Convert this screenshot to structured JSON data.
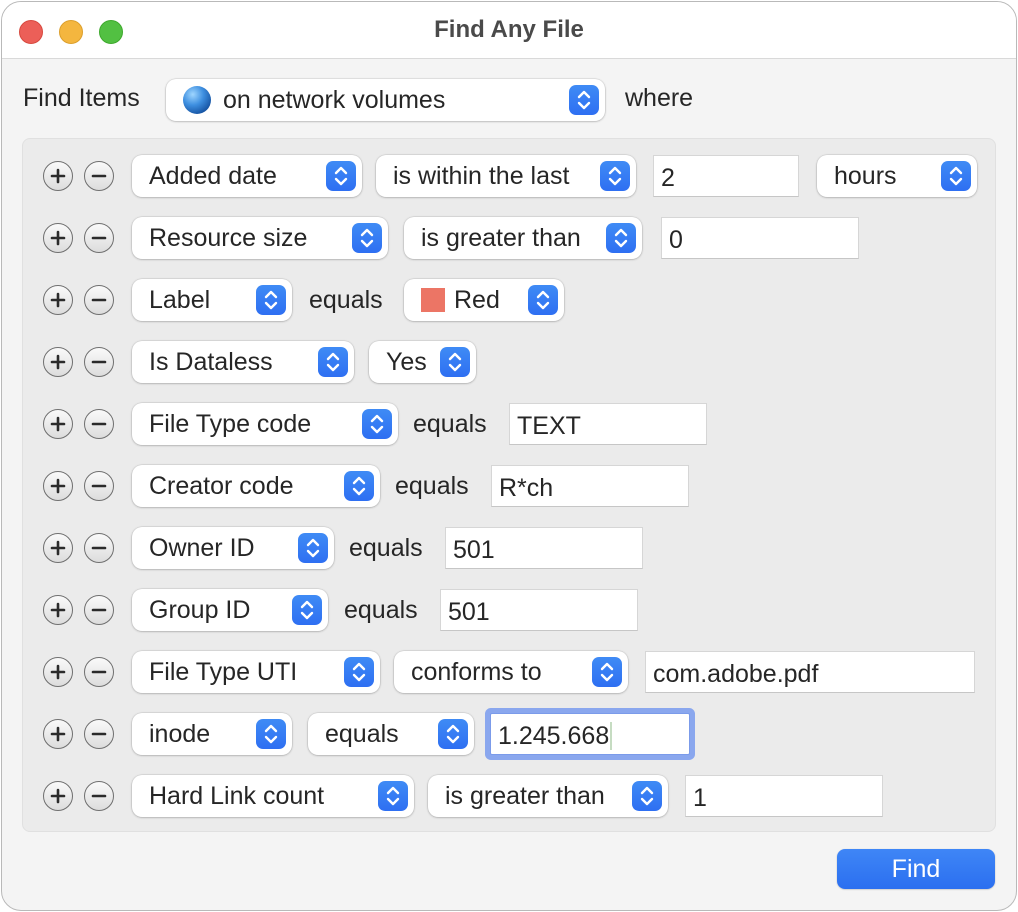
{
  "window": {
    "title": "Find Any File",
    "traffic_lights": [
      "close",
      "minimize",
      "zoom"
    ]
  },
  "header": {
    "find_items_label": "Find Items",
    "scope_popup": {
      "icon": "network-globe-icon",
      "value": "on network volumes"
    },
    "where_label": "where"
  },
  "criteria": [
    {
      "attribute": "Added date",
      "operator": "is within the last",
      "value": "2",
      "unit": "hours"
    },
    {
      "attribute": "Resource size",
      "operator": "is greater than",
      "value": "0"
    },
    {
      "attribute": "Label",
      "operator_label": "equals",
      "value_popup": "Red",
      "swatch_color": "#ec7565"
    },
    {
      "attribute": "Is Dataless",
      "value_popup": "Yes"
    },
    {
      "attribute": "File Type code",
      "operator_label": "equals",
      "value": "TEXT"
    },
    {
      "attribute": "Creator code",
      "operator_label": "equals",
      "value": "R*ch"
    },
    {
      "attribute": "Owner ID",
      "operator_label": "equals",
      "value": "501"
    },
    {
      "attribute": "Group ID",
      "operator_label": "equals",
      "value": "501"
    },
    {
      "attribute": "File Type UTI",
      "operator": "conforms to",
      "value": "com.adobe.pdf"
    },
    {
      "attribute": "inode",
      "operator": "equals",
      "value": "1.245.668",
      "focused": true
    },
    {
      "attribute": "Hard Link count",
      "operator": "is greater than",
      "value": "1"
    }
  ],
  "row_buttons": {
    "add": "+",
    "remove": "−"
  },
  "footer": {
    "find_label": "Find"
  },
  "colors": {
    "accent": "#3478f6",
    "focus_ring": "#8aa7ee",
    "label_red": "#ec7565"
  }
}
